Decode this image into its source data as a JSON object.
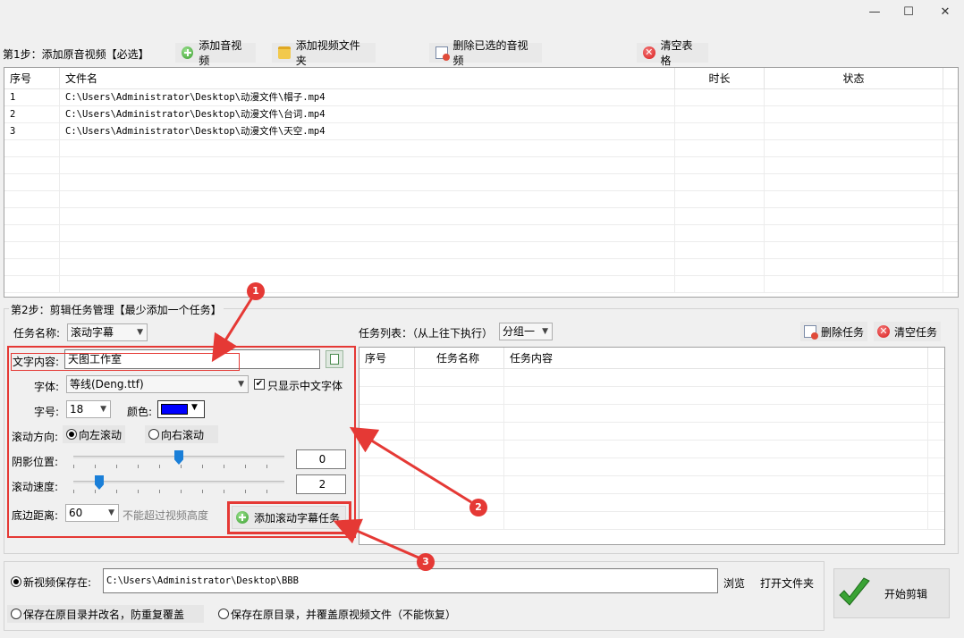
{
  "window": {
    "minimize_glyph": "—",
    "maximize_glyph": "☐",
    "close_glyph": "✕"
  },
  "step1": {
    "title": "第1步：添加原音视频【必选】",
    "add_media_label": "添加音视频",
    "add_folder_label": "添加视频文件夹",
    "delete_selected_label": "删除已选的音视频",
    "clear_table_label": "清空表格",
    "table": {
      "headers": [
        "序号",
        "文件名",
        "时长",
        "状态"
      ],
      "rows": [
        [
          "1",
          "C:\\Users\\Administrator\\Desktop\\动漫文件\\帽子.mp4",
          "",
          ""
        ],
        [
          "2",
          "C:\\Users\\Administrator\\Desktop\\动漫文件\\台词.mp4",
          "",
          ""
        ],
        [
          "3",
          "C:\\Users\\Administrator\\Desktop\\动漫文件\\天空.mp4",
          "",
          ""
        ]
      ]
    }
  },
  "step2": {
    "title": "第2步：剪辑任务管理【最少添加一个任务】",
    "task_name_label": "任务名称:",
    "task_name_value": "滚动字幕",
    "task_list_label": "任务列表：（从上往下执行）",
    "group_value": "分组一",
    "delete_task_label": "删除任务",
    "clear_task_label": "清空任务",
    "task_table_headers": [
      "序号",
      "任务名称",
      "任务内容"
    ],
    "text_label": "文字内容:",
    "text_value": "天图工作室",
    "font_label": "字体:",
    "font_value": "等线(Deng.ttf)",
    "only_chinese_label": "只显示中文字体",
    "size_label": "字号:",
    "size_value": "18",
    "color_label": "颜色:",
    "color_value": "#0000ff",
    "direction_label": "滚动方向:",
    "dir_left_label": "向左滚动",
    "dir_right_label": "向右滚动",
    "shadow_label": "阴影位置:",
    "shadow_value": "0",
    "speed_label": "滚动速度:",
    "speed_value": "2",
    "bottom_label": "底边距离:",
    "bottom_value": "60",
    "bottom_hint": "不能超过视频高度",
    "add_task_label": "添加滚动字幕任务"
  },
  "save": {
    "new_path_label": "新视频保存在:",
    "path_value": "C:\\Users\\Administrator\\Desktop\\BBB",
    "browse_label": "浏览",
    "open_folder_label": "打开文件夹",
    "option2_label": "保存在原目录并改名，防重复覆盖",
    "option3_label": "保存在原目录，并覆盖原视频文件（不能恢复）",
    "start_label": "开始剪辑"
  },
  "annotations": {
    "badge1": "1",
    "badge2": "2",
    "badge3": "3"
  },
  "colors": {
    "annotation": "#e53935",
    "accent_blue": "#1a7fd8"
  }
}
